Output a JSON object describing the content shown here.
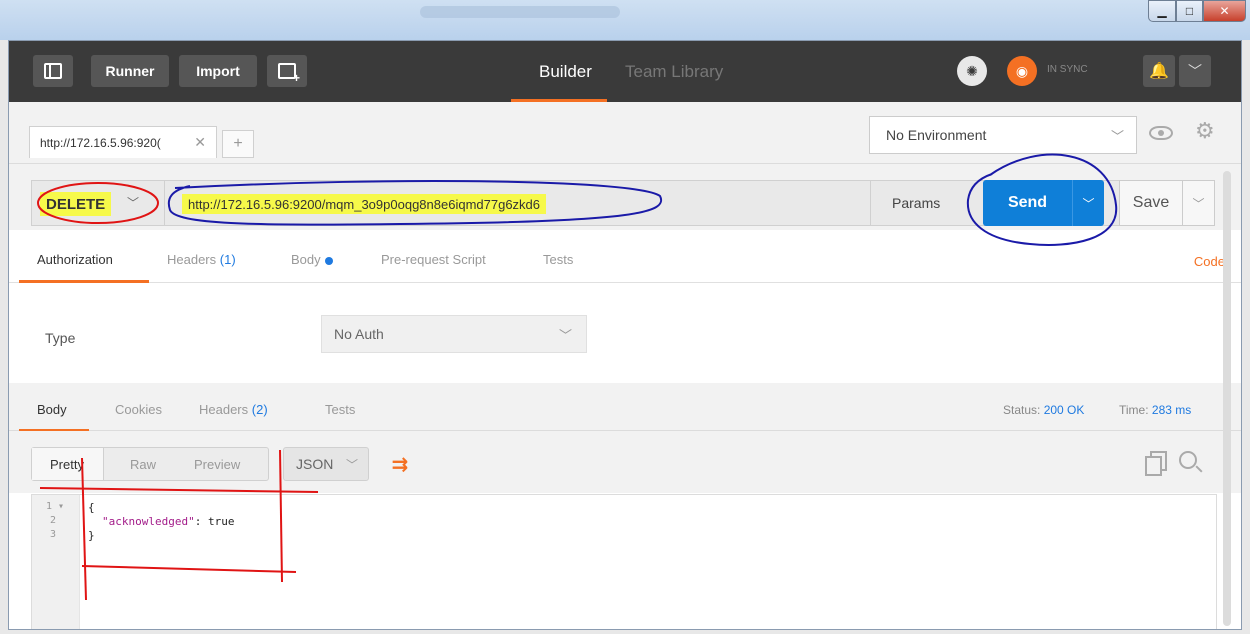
{
  "colors": {
    "accent_orange": "#f47023",
    "send_blue": "#0f7fd8",
    "highlight_yellow": "#f6f94a",
    "link_blue": "#1f7ae0",
    "topbar_dark": "#3a3a3a"
  },
  "topbar": {
    "sidebar_icon": "sidebar-toggle-icon",
    "runner_label": "Runner",
    "import_label": "Import",
    "new_window_icon": "new-window-icon",
    "builder_label": "Builder",
    "team_library_label": "Team Library",
    "interceptor_icon": "satellite-icon",
    "sync_icon": "sync-icon",
    "sync_label": "IN SYNC",
    "bell_icon": "bell-icon",
    "menu_icon": "chevron-down-icon"
  },
  "tabs": {
    "request_tab_label": "http://172.16.5.96:920(",
    "close_glyph": "✕",
    "add_glyph": "+"
  },
  "environment": {
    "selected": "No Environment"
  },
  "request": {
    "method": "DELETE",
    "url": "http://172.16.5.96:9200/mqm_3o9p0oqg8n8e6iqmd77g6zkd6",
    "params_label": "Params",
    "send_label": "Send",
    "save_label": "Save"
  },
  "request_tabs": {
    "authorization": "Authorization",
    "headers": "Headers",
    "headers_count": "(1)",
    "body": "Body",
    "pre_request": "Pre-request Script",
    "tests": "Tests",
    "code": "Code"
  },
  "auth": {
    "type_label": "Type",
    "type_value": "No Auth"
  },
  "response_tabs": {
    "body": "Body",
    "cookies": "Cookies",
    "headers": "Headers",
    "headers_count": "(2)",
    "tests": "Tests",
    "status_label": "Status:",
    "status_value": "200 OK",
    "time_label": "Time:",
    "time_value": "283 ms"
  },
  "response_toolbar": {
    "pretty": "Pretty",
    "raw": "Raw",
    "preview": "Preview",
    "format": "JSON"
  },
  "editor": {
    "lines": [
      {
        "num": "1 ▾",
        "text": "{"
      },
      {
        "num": "2",
        "key": "\"acknowledged\"",
        "rest": ": true"
      },
      {
        "num": "3",
        "text": "}"
      }
    ]
  }
}
